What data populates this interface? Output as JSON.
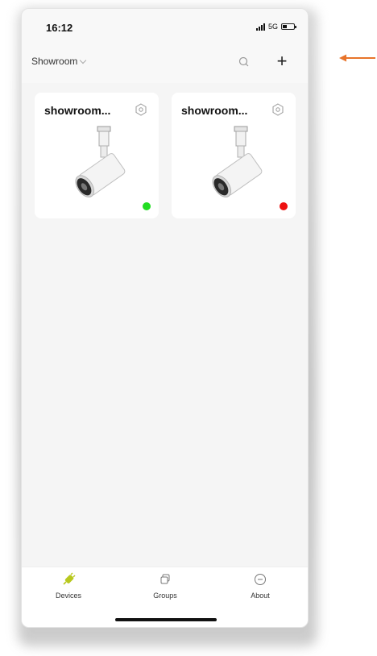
{
  "status_bar": {
    "time": "16:12",
    "network": "5G"
  },
  "header": {
    "location": "Showroom",
    "add_label": "+"
  },
  "devices": [
    {
      "name": "showroom...",
      "status": "online",
      "status_color": "#22dd22"
    },
    {
      "name": "showroom...",
      "status": "offline",
      "status_color": "#ee1111"
    }
  ],
  "tabs": [
    {
      "label": "Devices",
      "icon": "device-plug-icon",
      "active_color": "#b8c81e"
    },
    {
      "label": "Groups",
      "icon": "groups-icon"
    },
    {
      "label": "About",
      "icon": "about-circle-icon"
    }
  ],
  "annotation": {
    "arrow_color": "#e8742a"
  }
}
